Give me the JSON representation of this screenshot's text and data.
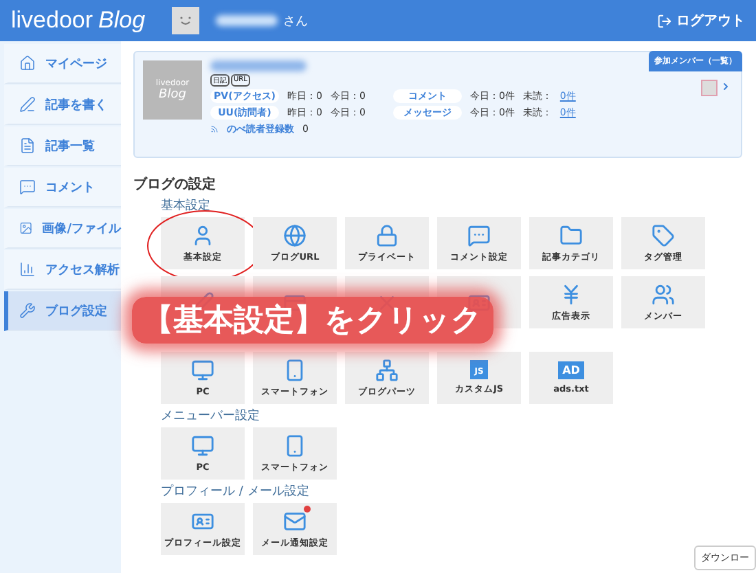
{
  "header": {
    "logo": "livedoor",
    "logo_script": "Blog",
    "user_suffix": "さん",
    "logout": "ログアウト"
  },
  "sidebar": {
    "items": [
      {
        "label": "マイページ",
        "kind": "home",
        "selected": false
      },
      {
        "label": "記事を書く",
        "kind": "pen",
        "selected": false
      },
      {
        "label": "記事一覧",
        "kind": "doc",
        "selected": false
      },
      {
        "label": "コメント",
        "kind": "comment",
        "selected": false
      },
      {
        "label": "画像/ファイル",
        "kind": "image",
        "selected": false
      },
      {
        "label": "アクセス解析",
        "kind": "chart",
        "selected": false
      },
      {
        "label": "ブログ設定",
        "kind": "wrench",
        "selected": true
      }
    ]
  },
  "summary": {
    "thumb_top": "livedoor",
    "thumb_bottom": "Blog",
    "tags": [
      "日記",
      "URL"
    ],
    "stats": [
      {
        "label": "PV(アクセス)",
        "yesterday": "昨日：0",
        "today": "今日：0"
      },
      {
        "label": "UU(訪問者)",
        "yesterday": "昨日：0",
        "today": "今日：0"
      }
    ],
    "messages": [
      {
        "label": "コメント",
        "today": "今日：0件",
        "unread_label": "未読：",
        "unread": "0件"
      },
      {
        "label": "メッセージ",
        "today": "今日：0件",
        "unread_label": "未読：",
        "unread": "0件"
      }
    ],
    "readers_label": "のべ読者登録数",
    "readers_value": "0",
    "members_button": "参加メンバー（一覧）"
  },
  "title": "ブログの設定",
  "sections": [
    {
      "heading": "基本設定",
      "tiles": [
        {
          "label": "基本設定",
          "kind": "user",
          "circled": true
        },
        {
          "label": "ブログURL",
          "kind": "globe",
          "circled": false
        },
        {
          "label": "プライベート",
          "kind": "lock",
          "circled": false
        },
        {
          "label": "コメント設定",
          "kind": "comment",
          "circled": false
        },
        {
          "label": "記事カテゴリ",
          "kind": "folder",
          "circled": false
        },
        {
          "label": "タグ管理",
          "kind": "tag",
          "circled": false
        },
        {
          "kind": "pen",
          "circled": false
        },
        {
          "kind": "card",
          "circled": false
        },
        {
          "kind": "cross",
          "circled": false
        },
        {
          "kind": "id",
          "circled": false
        },
        {
          "label": "広告表示",
          "kind": "yen",
          "circled": false
        },
        {
          "label": "メンバー",
          "kind": "users",
          "circled": false
        }
      ]
    },
    {
      "tiles": [
        {
          "label": "PC",
          "kind": "monitor",
          "circled": false
        },
        {
          "label": "スマートフォン",
          "kind": "phone",
          "circled": false
        },
        {
          "label": "ブログパーツ",
          "kind": "parts",
          "circled": false
        },
        {
          "label": "カスタムJS",
          "kind": "js",
          "badge": "JS",
          "circled": false
        },
        {
          "label": "ads.txt",
          "kind": "ad",
          "badge": "AD",
          "circled": false
        }
      ]
    },
    {
      "heading": "メニューバー設定",
      "tiles": [
        {
          "label": "PC",
          "kind": "monitor",
          "circled": false
        },
        {
          "label": "スマートフォン",
          "kind": "phone",
          "circled": false
        }
      ]
    },
    {
      "heading": "プロフィール / メール設定",
      "tiles": [
        {
          "label": "プロフィール設定",
          "kind": "id",
          "circled": false
        },
        {
          "label": "メール通知設定",
          "kind": "mail",
          "notification": true,
          "circled": false
        }
      ]
    }
  ],
  "annotation": "【基本設定】をクリック",
  "tooltip": "ダウンロー"
}
